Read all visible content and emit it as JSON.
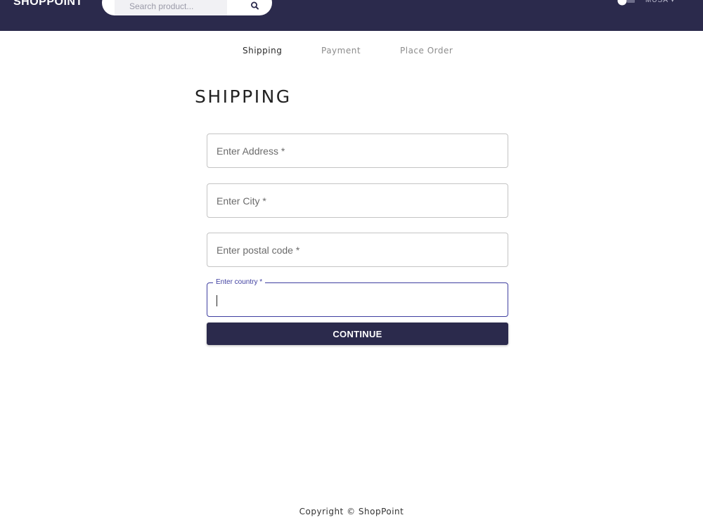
{
  "header": {
    "brand": "SHOPPOINT",
    "search": {
      "placeholder": "Search product...",
      "icon": "search-icon"
    },
    "cart_icon": "cart-icon",
    "user_menu_label": "MUSA ▾",
    "background_color": "#2b2a4c"
  },
  "steps": [
    {
      "label": "Shipping",
      "state": "active"
    },
    {
      "label": "Payment",
      "state": "disabled"
    },
    {
      "label": "Place Order",
      "state": "disabled"
    }
  ],
  "page_title": "SHIPPING",
  "form": {
    "address_placeholder": "Enter Address *",
    "city_placeholder": "Enter City *",
    "postal_placeholder": "Enter postal code *",
    "country_label": "Enter country *",
    "country_value": "",
    "focus_color": "#3f3fa0"
  },
  "continue_label": "CONTINUE",
  "footer_text": "Copyright © ShopPoint"
}
